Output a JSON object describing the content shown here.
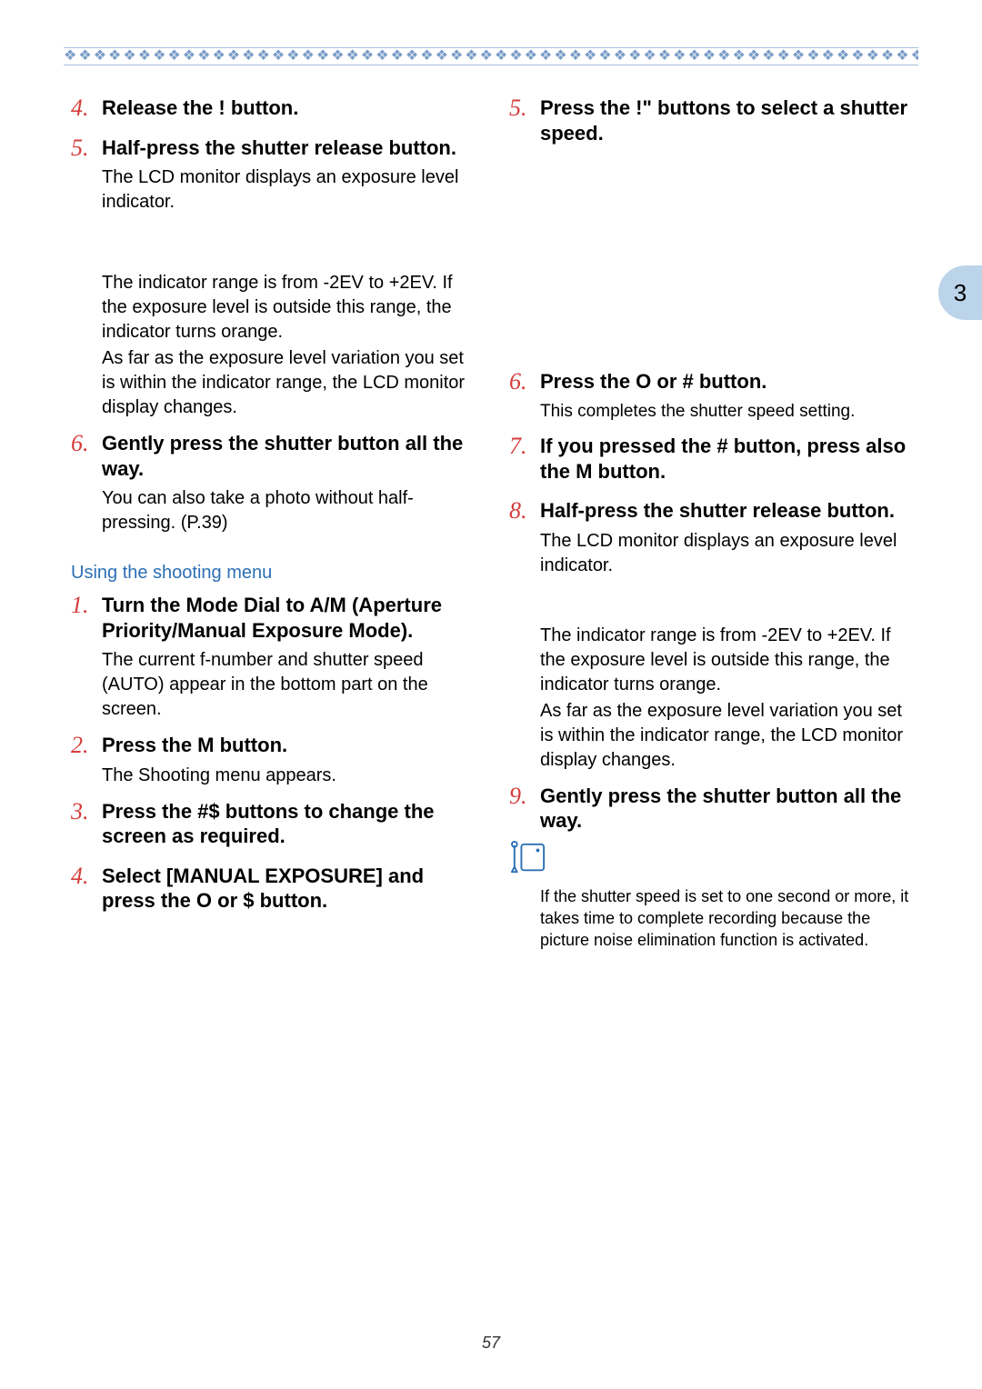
{
  "divider_pattern": "❖❖❖❖❖❖❖❖❖❖❖❖❖❖❖❖❖❖❖❖❖❖❖❖❖❖❖❖❖❖❖❖❖❖❖❖❖❖❖❖❖❖❖❖❖❖❖❖❖❖❖❖❖❖❖❖❖❖❖❖❖❖❖❖",
  "page_tab": "3",
  "page_number": "57",
  "left": {
    "step4": {
      "num": "4.",
      "title": "Release the !   button."
    },
    "step5": {
      "num": "5.",
      "title": "Half-press the shutter release button.",
      "body1": "The LCD monitor displays an exposure level indicator.",
      "body2": "The indicator range is from -2EV to +2EV. If the exposure level is outside this range, the indicator turns orange.",
      "body3": "As far as  the exposure level variation you set is within the indicator range, the LCD monitor display changes."
    },
    "step6": {
      "num": "6.",
      "title": "Gently press the shutter button all the way.",
      "body1": "You can also take a photo without half-pressing. (P.39)"
    },
    "subheading": "Using the shooting menu",
    "m1": {
      "num": "1.",
      "title": "Turn the Mode Dial to A/M (Aperture Priority/Manual Exposure Mode).",
      "body1": "The current f-number and shutter speed (AUTO) appear in the bottom part on the screen."
    },
    "m2": {
      "num": "2.",
      "title": "Press the M         button.",
      "body1": "The Shooting menu appears."
    },
    "m3": {
      "num": "3.",
      "title": "Press the #$   buttons to change the screen as required."
    },
    "m4": {
      "num": "4.",
      "title": "Select [MANUAL EXPOSURE] and press the O   or $  button."
    }
  },
  "right": {
    "step5": {
      "num": "5.",
      "title": "Press the !\"      buttons to select a shutter speed."
    },
    "step6": {
      "num": "6.",
      "title": "Press the O   or #  button.",
      "body1": "This completes the shutter speed setting."
    },
    "step7": {
      "num": "7.",
      "title": "If you pressed the #  button, press also the M          button."
    },
    "step8": {
      "num": "8.",
      "title": "Half-press the shutter release button.",
      "body1": "The LCD monitor displays an exposure level indicator.",
      "body2": "The indicator range is from -2EV to +2EV. If the exposure level is outside this range, the indicator turns orange.",
      "body3": "As far as  the exposure level variation you set is within the indicator range, the LCD monitor display changes."
    },
    "step9": {
      "num": "9.",
      "title": "Gently press the shutter button all the way."
    },
    "note": "If the shutter speed is set to one second or more, it takes time to complete recording because the picture noise elimination function is activated."
  }
}
